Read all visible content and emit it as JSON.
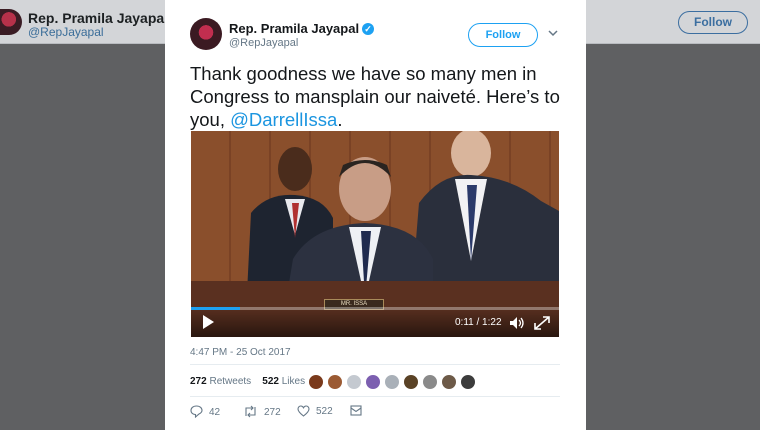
{
  "background_profile": {
    "name": "Rep. Pramila Jayapal",
    "handle": "@RepJayapal",
    "follow_label": "Follow"
  },
  "tweet": {
    "author_name": "Rep. Pramila Jayapal",
    "author_handle": "@RepJayapal",
    "follow_label": "Follow",
    "text_before": "Thank goodness we have so many men in Congress to mansplain our naiveté. Here’s to you, ",
    "mention": "@DarrellIssa",
    "text_after": ".",
    "timestamp": "4:47 PM - 25 Oct 2017",
    "retweets_count": "272",
    "retweets_label": "Retweets",
    "likes_count": "522",
    "likes_label": "Likes",
    "actions": {
      "reply_count": "42",
      "retweet_count": "272",
      "like_count": "522"
    }
  },
  "video": {
    "time": "0:11 / 1:22",
    "progress_fraction": 0.134,
    "nameplate": "MR. ISSA"
  },
  "colors": {
    "brand_blue": "#1da1f2",
    "mention_blue": "#1b95e0",
    "text_primary": "#14171a",
    "text_secondary": "#657786"
  },
  "likers_colors": [
    "#7a3a1c",
    "#9b5a33",
    "#c4c9d0",
    "#7c5fb0",
    "#a9b0b8",
    "#5a4226",
    "#8a8a8a",
    "#6d5a48",
    "#3c3c3c"
  ]
}
